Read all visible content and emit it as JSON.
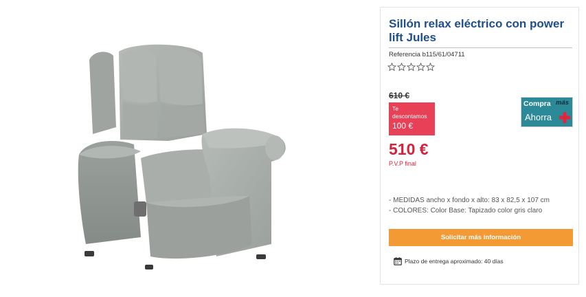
{
  "product": {
    "title": "Sillón relax eléctrico con power lift Jules",
    "reference": "Referencia b115/61/04711",
    "rating": {
      "stars_total": 5,
      "stars_filled": 0
    },
    "image_icon": "armchair-photo",
    "color": "gris claro"
  },
  "pricing": {
    "old_price": "610 €",
    "discount_label": "Te descontamos",
    "discount_amount": "100 €",
    "final_price": "510 €",
    "pvp_label": "P.V.P final"
  },
  "promo_logo": {
    "word1": "Compra",
    "word2": "más",
    "word3": "Ahorra",
    "icon": "plus-icon"
  },
  "features": [
    "- MEDIDAS ancho x fondo x alto: 83 x 82,5 x 107 cm",
    "- COLORES: Color Base: Tapizado color gris claro"
  ],
  "cta": {
    "label": "Solicitar más información"
  },
  "delivery": {
    "icon": "calendar-icon",
    "text": "Plazo de entrega aproximado: 40 días"
  },
  "colors": {
    "title": "#1e4e8c",
    "sale": "#d6213a",
    "discount_bg": "#e84056",
    "button": "#f39a35",
    "promo_bg": "#2c8a98",
    "upholstery": "#a7aca8"
  }
}
